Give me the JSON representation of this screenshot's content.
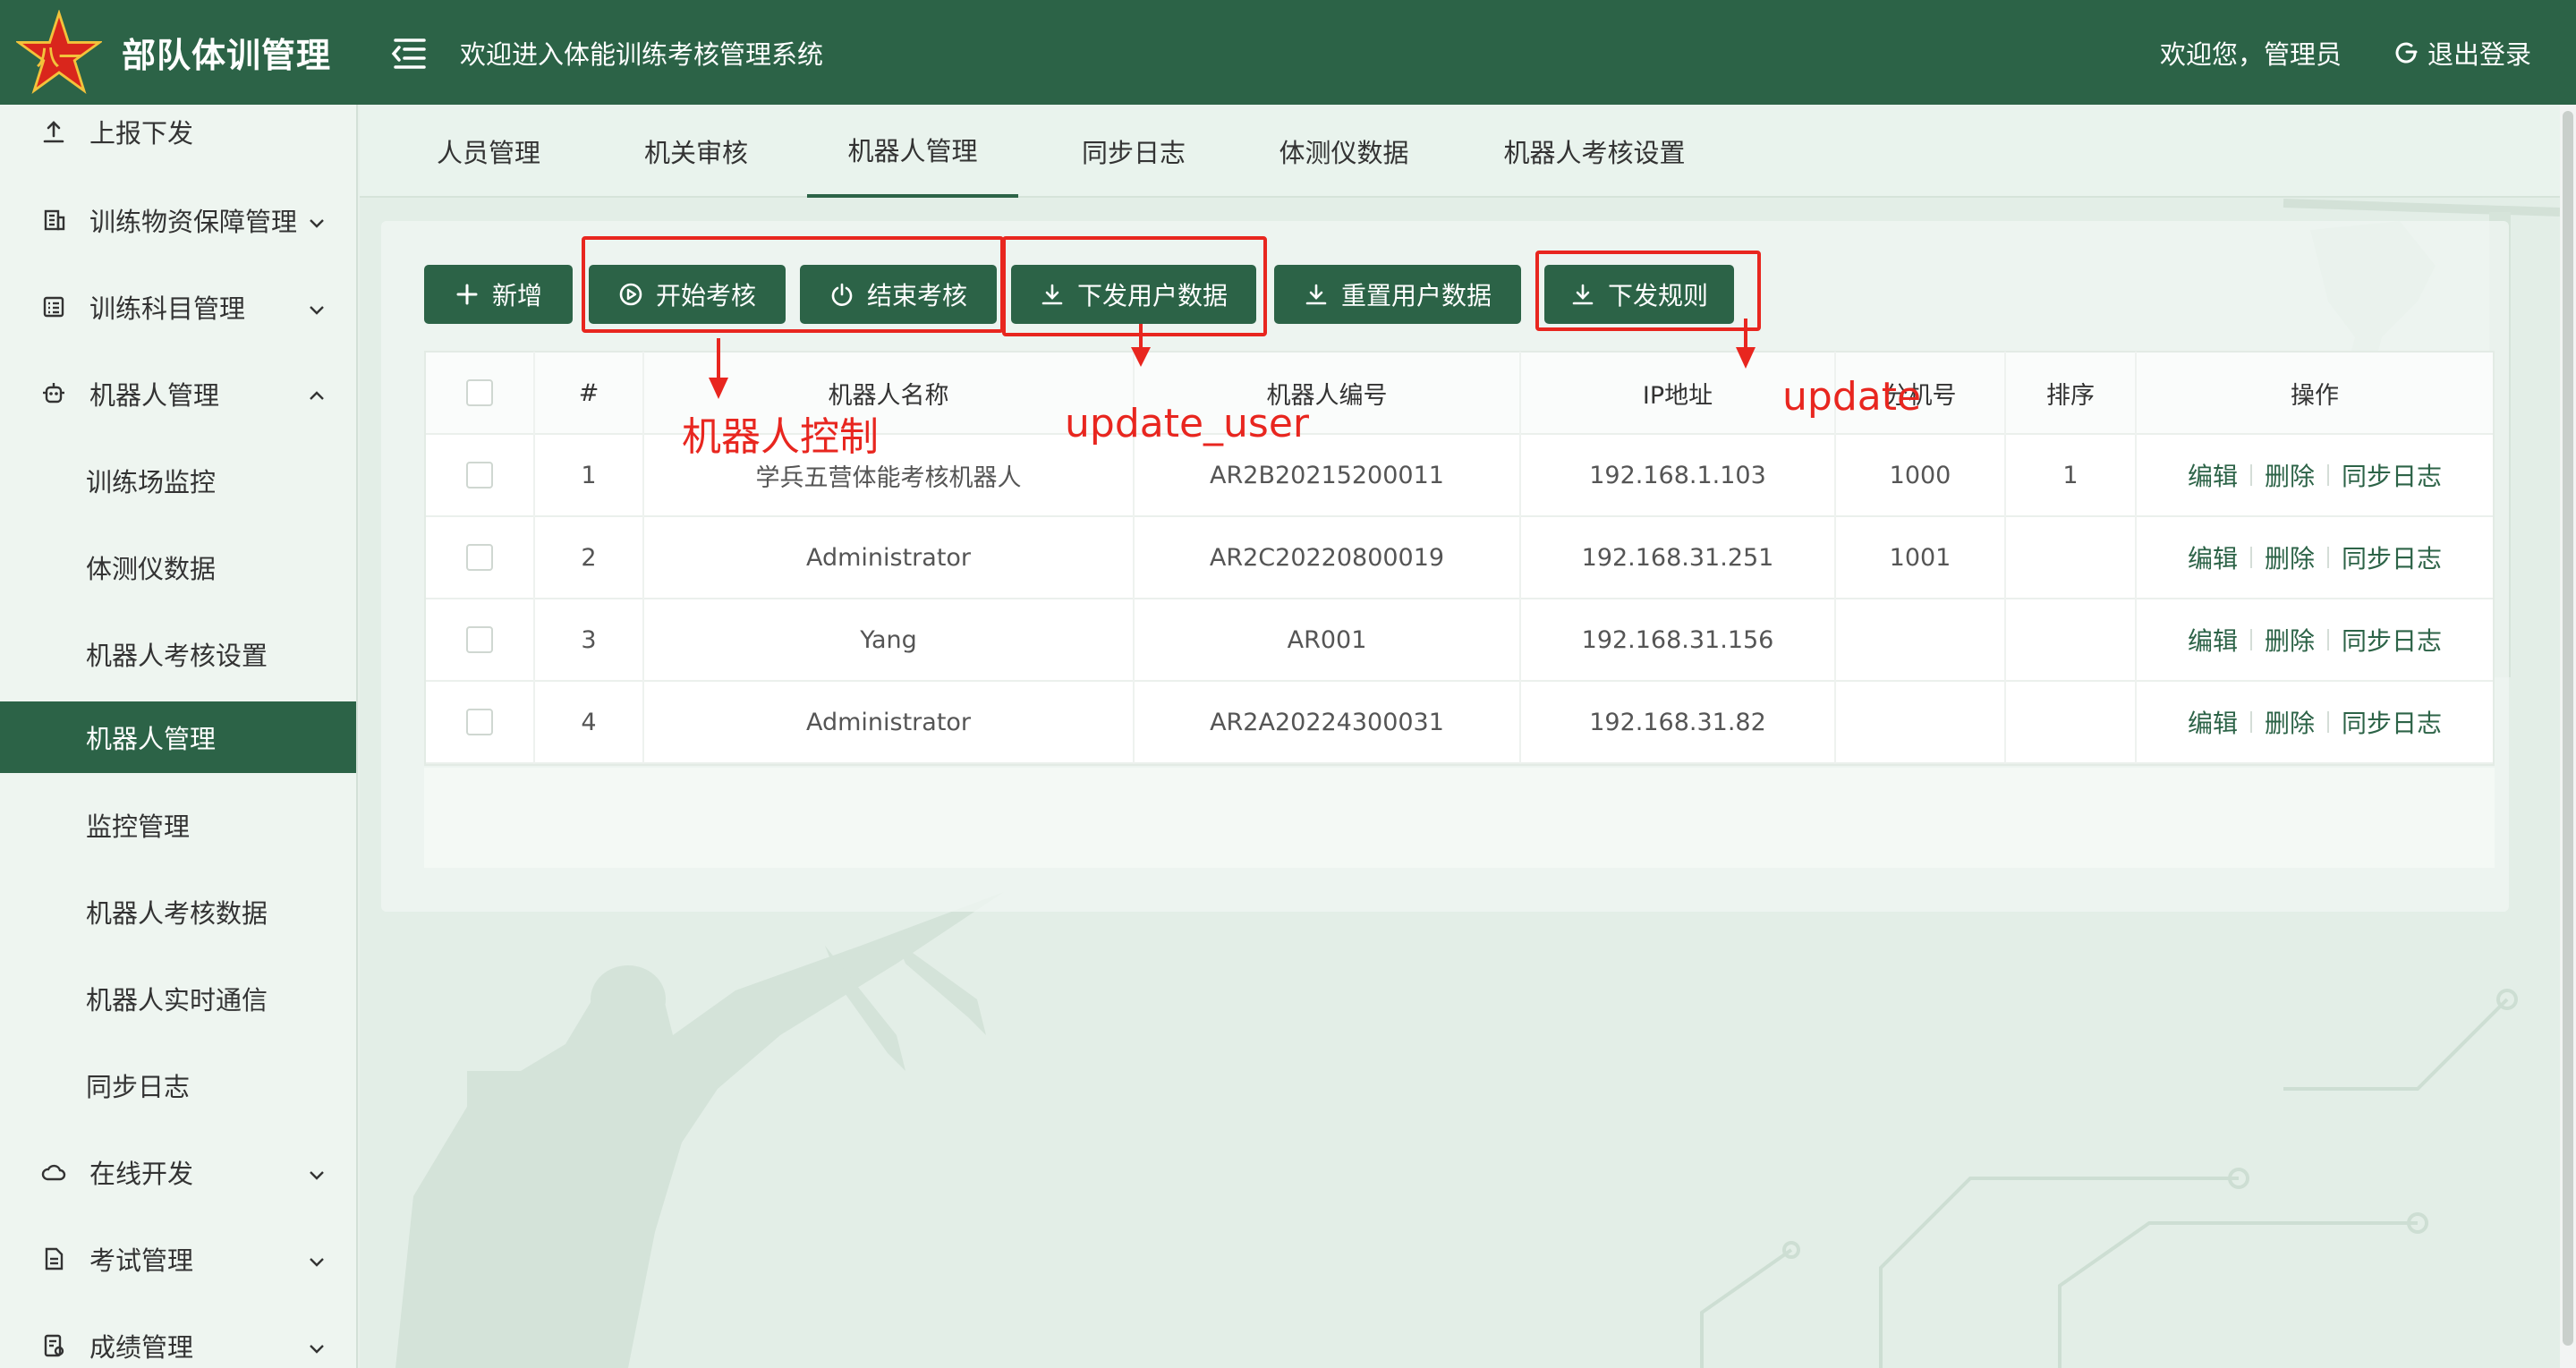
{
  "header": {
    "logo_text": "部队体训管理",
    "logo_badge": "八一",
    "welcome_title": "欢迎进入体能训练考核管理系统",
    "user_greet": "欢迎您，管理员",
    "logout_label": "退出登录",
    "brand_color": "#2c6347"
  },
  "sidebar": {
    "items": [
      {
        "label": "上报下发",
        "icon": "upload-icon"
      },
      {
        "label": "训练物资保障管理",
        "icon": "building-icon"
      },
      {
        "label": "训练科目管理",
        "icon": "list-icon"
      },
      {
        "label": "机器人管理",
        "icon": "robot-icon"
      },
      {
        "label": "训练场监控"
      },
      {
        "label": "体测仪数据"
      },
      {
        "label": "机器人考核设置"
      },
      {
        "label": "机器人管理"
      },
      {
        "label": "监控管理"
      },
      {
        "label": "机器人考核数据"
      },
      {
        "label": "机器人实时通信"
      },
      {
        "label": "同步日志"
      },
      {
        "label": "在线开发",
        "icon": "cloud-icon"
      },
      {
        "label": "考试管理",
        "icon": "document-icon"
      },
      {
        "label": "成绩管理",
        "icon": "score-icon"
      }
    ]
  },
  "tabs": [
    "人员管理",
    "机关审核",
    "机器人管理",
    "同步日志",
    "体测仪数据",
    "机器人考核设置"
  ],
  "toolbar": {
    "add": "新增",
    "start_exam": "开始考核",
    "end_exam": "结束考核",
    "push_user_data": "下发用户数据",
    "reset_user_data": "重置用户数据",
    "push_rules": "下发规则"
  },
  "table": {
    "headers": [
      "#",
      "机器人名称",
      "机器人编号",
      "IP地址",
      "分机号",
      "排序",
      "操作"
    ],
    "rows": [
      {
        "index": "1",
        "name": "学兵五营体能考核机器人",
        "code": "AR2B20215200011",
        "ip": "192.168.1.103",
        "ext": "1000",
        "order": "1"
      },
      {
        "index": "2",
        "name": "Administrator",
        "code": "AR2C20220800019",
        "ip": "192.168.31.251",
        "ext": "1001",
        "order": ""
      },
      {
        "index": "3",
        "name": "Yang",
        "code": "AR001",
        "ip": "192.168.31.156",
        "ext": "",
        "order": ""
      },
      {
        "index": "4",
        "name": "Administrator",
        "code": "AR2A20224300031",
        "ip": "192.168.31.82",
        "ext": "",
        "order": ""
      }
    ],
    "ops": {
      "edit": "编辑",
      "delete": "删除",
      "sync_log": "同步日志"
    }
  },
  "annotations": {
    "robot_control": "机器人控制",
    "update_user": "update_user",
    "update": "update",
    "color": "#e8261f"
  }
}
